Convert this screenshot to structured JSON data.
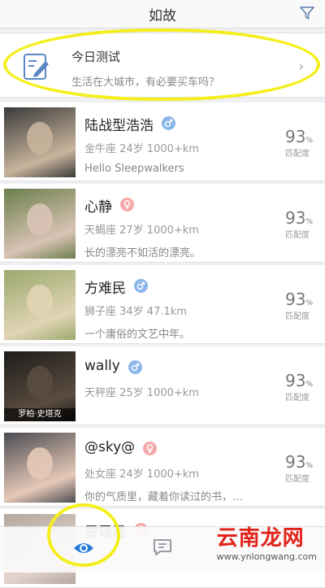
{
  "topbar": {
    "title": "如故",
    "filter_icon": "filter-icon"
  },
  "daily_test": {
    "title": "今日测试",
    "subtitle": "生活在大城市，有必要买车吗？",
    "icon": "test-paper-icon"
  },
  "match_label": "匹配度",
  "percent_unit": "%",
  "users": [
    {
      "name": "陆战型浩浩",
      "gender": "male",
      "meta": "金牛座 24岁 1000+km",
      "bio": "Hello Sleepwalkers",
      "match": "93",
      "avatar_caption": ""
    },
    {
      "name": "心静",
      "gender": "female",
      "meta": "天蝎座 27岁 1000+km",
      "bio": "长的漂亮不如活的漂亮。",
      "match": "93",
      "avatar_caption": ""
    },
    {
      "name": "方难民",
      "gender": "male",
      "meta": "狮子座 34岁 47.1km",
      "bio": "一个庸俗的文艺中年。",
      "match": "93",
      "avatar_caption": ""
    },
    {
      "name": "wally",
      "gender": "male",
      "meta": "天秤座 25岁 1000+km",
      "bio": "",
      "match": "93",
      "avatar_caption": "罗柏·史塔克"
    },
    {
      "name": "@sky@",
      "gender": "female",
      "meta": "处女座 24岁 1000+km",
      "bio": "你的气质里，藏着你读过的书，…",
      "match": "93",
      "avatar_caption": ""
    }
  ],
  "partial_user": {
    "name": "雾霜霰"
  },
  "tabbar": {
    "eye_icon": "eye-icon",
    "message_icon": "message-icon"
  },
  "watermark": {
    "main": "云南龙网",
    "sub": "www.ynlongwang.com"
  },
  "colors": {
    "male": "#8bb6ea",
    "female": "#f6a9a9",
    "highlight": "#f4ef1c",
    "tab_active": "#2a7bd8"
  }
}
